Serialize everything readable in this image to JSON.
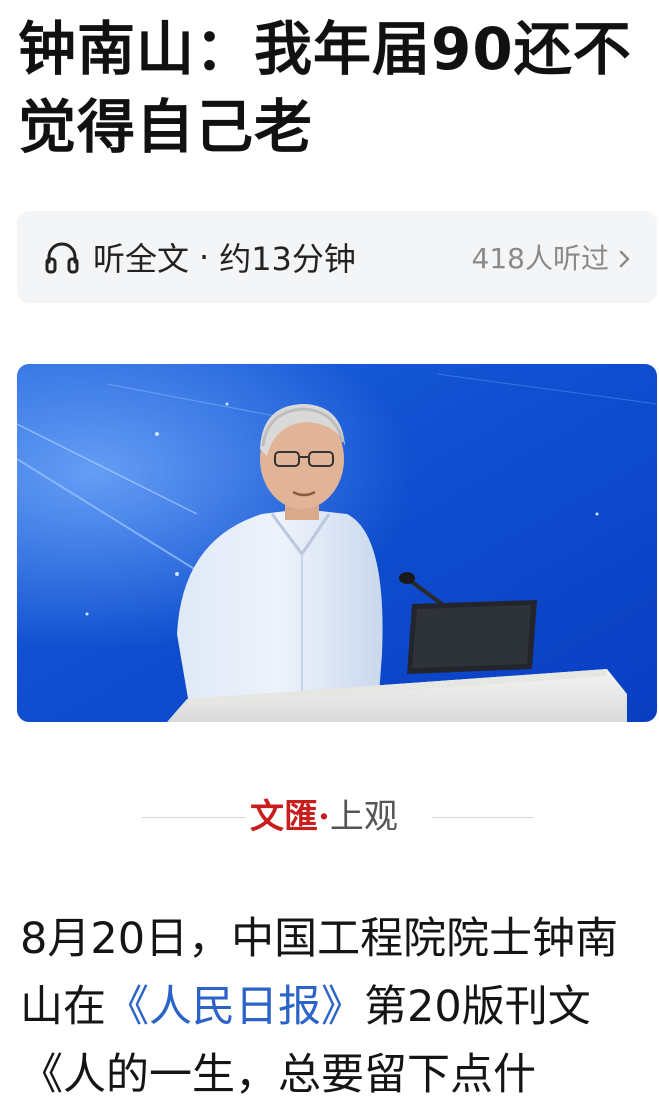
{
  "article": {
    "title": "钟南山：我年届90还不觉得自己老"
  },
  "listen": {
    "label": "听全文",
    "separator": "·",
    "duration": "约13分钟",
    "listeners": "418人听过",
    "icon": "headphone-icon",
    "chevron_icon": "chevron-right-icon"
  },
  "photo": {
    "subject": "speaker-at-podium"
  },
  "source": {
    "name_primary": "文匯",
    "separator": "·",
    "name_secondary": "上观",
    "primary_color": "#c81e1e"
  },
  "body": {
    "part1": "8月20日，中国工程院院士钟南山在",
    "link": "《人民日报》",
    "part2": "第20版刊文《人的一生，总要留下点什",
    "link_color": "#2b63c9"
  }
}
